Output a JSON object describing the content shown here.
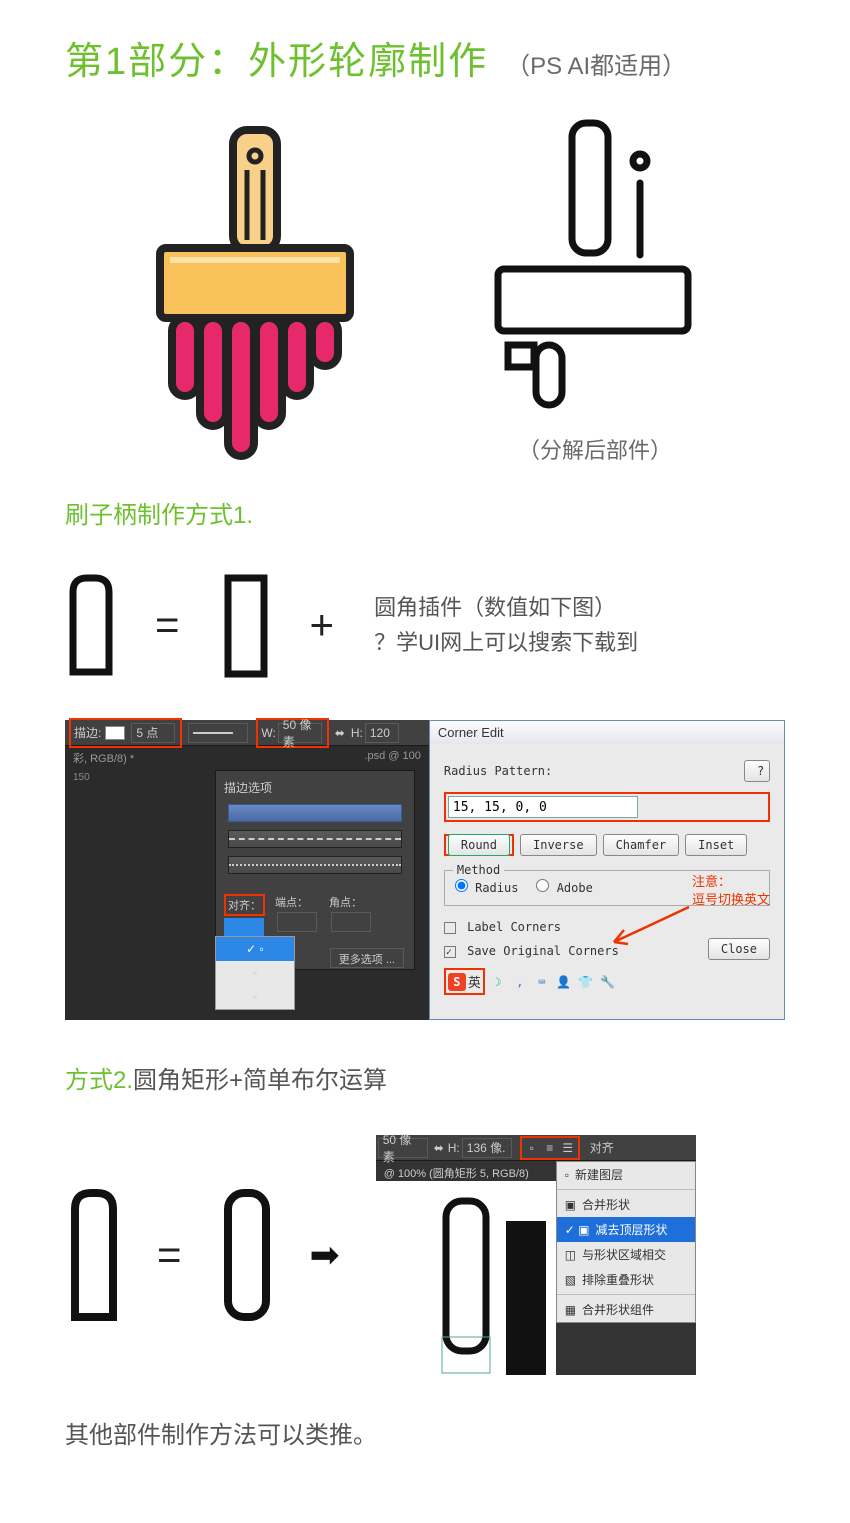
{
  "header": {
    "title": "第1部分：外形轮廓制作",
    "subtitle": "（PS AI都适用）"
  },
  "illustration": {
    "caption": "（分解后部件）"
  },
  "section1": {
    "label": "刷子柄制作方式1.",
    "text_line1": "圆角插件（数值如下图）",
    "text_line2": "？学UI网上可以搜索下载到"
  },
  "ps_panel": {
    "stroke_label": "描边:",
    "stroke_size": "5 点",
    "w_label": "W:",
    "w_value": "50 像素",
    "h_label": "H:",
    "h_value": "120",
    "doc_info": "彩, RGB/8) *",
    "zoom_info": ".psd @ 100",
    "ruler": "150",
    "options_title": "描边选项",
    "align_label": "对齐：",
    "cap_label": "端点：",
    "corner_label": "角点：",
    "more_options": "更多选项 ..."
  },
  "corner_dialog": {
    "title": "Corner Edit",
    "radius_label": "Radius Pattern:",
    "radius_value": "15, 15, 0, 0",
    "help": "?",
    "btn_round": "Round",
    "btn_inverse": "Inverse",
    "btn_chamfer": "Chamfer",
    "btn_inset": "Inset",
    "method_label": "Method",
    "radio_radius": "Radius",
    "radio_adobe": "Adobe",
    "label_corners": "Label Corners",
    "save_original": "Save Original Corners",
    "btn_close": "Close",
    "note_line1": "注意：",
    "note_line2": "逗号切换英文",
    "ime_text": "英"
  },
  "section2": {
    "prefix": "方式2.",
    "rest": "圆角矩形+简单布尔运算"
  },
  "layer_panel": {
    "w_value": "50 像素",
    "h_label": "H:",
    "h_value": "136 像.",
    "doc_title": "@ 100% (圆角矩形 5, RGB/8)",
    "align_label": "对齐",
    "menu": {
      "new_layer": "新建图层",
      "merge_shapes": "合并形状",
      "subtract": "减去顶层形状",
      "intersect": "与形状区域相交",
      "exclude": "排除重叠形状",
      "combine": "合并形状组件"
    }
  },
  "footer": {
    "text": "其他部件制作方法可以类推。"
  }
}
